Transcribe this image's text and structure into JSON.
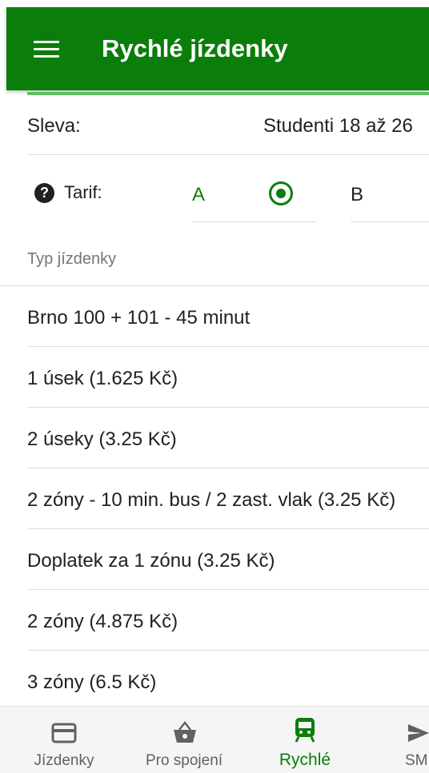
{
  "appbar": {
    "title": "Rychlé jízdenky",
    "menu_icon": "hamburger-menu-icon"
  },
  "discount": {
    "label": "Sleva:",
    "value": "Studenti 18 až 26"
  },
  "tariff": {
    "label": "Tarif:",
    "option_a": "A",
    "option_b": "B",
    "selected": "A"
  },
  "ticket_section": {
    "header": "Typ jízdenky"
  },
  "tickets": [
    "Brno 100 + 101 - 45 minut",
    "1 úsek (1.625 Kč)",
    "2 úseky (3.25 Kč)",
    "2 zóny - 10 min. bus / 2 zast. vlak (3.25 Kč)",
    "Doplatek za 1 zónu (3.25 Kč)",
    "2 zóny (4.875 Kč)",
    "3 zóny (6.5 Kč)"
  ],
  "bottom_nav": {
    "items": [
      {
        "label": "Jízdenky",
        "icon": "credit-card-icon"
      },
      {
        "label": "Pro spojení",
        "icon": "basket-icon"
      },
      {
        "label": "Rychlé",
        "icon": "train-icon"
      },
      {
        "label": "SM",
        "icon": "send-icon"
      }
    ],
    "active": "Rychlé"
  },
  "colors": {
    "primary": "#0b7d0b",
    "accent_line": "#5cc15c",
    "divider": "#dcdcdc",
    "text": "#212121",
    "muted": "#757575"
  }
}
